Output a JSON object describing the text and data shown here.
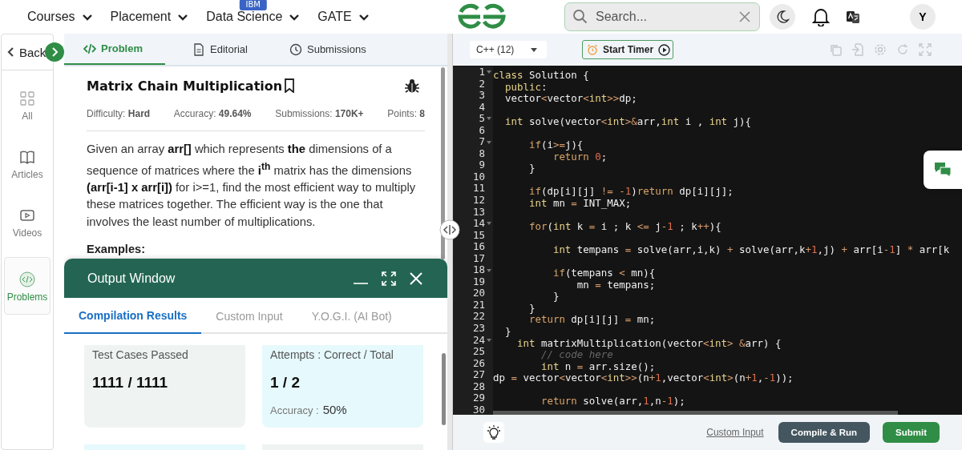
{
  "top_nav": {
    "menus": [
      {
        "label": "Courses"
      },
      {
        "label": "Placement"
      },
      {
        "label": "Data Science",
        "badge": "IBM"
      },
      {
        "label": "GATE"
      }
    ],
    "search": {
      "placeholder": "Search..."
    },
    "avatar": "Y"
  },
  "sidebar": {
    "back": "Back",
    "items": [
      {
        "label": "All",
        "selected": false
      },
      {
        "label": "Articles",
        "selected": false
      },
      {
        "label": "Videos",
        "selected": false
      },
      {
        "label": "Problems",
        "selected": true
      }
    ]
  },
  "problem_tabs": [
    {
      "label": "Problem",
      "selected": true
    },
    {
      "label": "Editorial",
      "selected": false
    },
    {
      "label": "Submissions",
      "selected": false
    }
  ],
  "problem": {
    "title": "Matrix Chain Multiplication",
    "meta": [
      {
        "label": "Difficulty:",
        "value": "Hard"
      },
      {
        "label": "Accuracy:",
        "value": "49.64%"
      },
      {
        "label": "Submissions:",
        "value": "170K+"
      },
      {
        "label": "Points:",
        "value": "8"
      }
    ],
    "description": "Given an array **arr[]** which represents **the** dimensions of a sequence of matrices where the **i**$^{th}$ matrix has the dimensions **(arr[i-1] x arr[i])** for i>=1, find the most efficient way to multiply these matrices together. The efficient way is the one that involves the least number of multiplications.",
    "examples_heading": "Examples:"
  },
  "output_window": {
    "title": "Output Window",
    "tabs": [
      {
        "label": "Compilation Results",
        "selected": true
      },
      {
        "label": "Custom Input",
        "selected": false
      },
      {
        "label": "Y.O.G.I. (AI Bot)",
        "selected": false
      }
    ],
    "cards": [
      {
        "label": "Test Cases Passed",
        "value": "1111 / 1111",
        "color": "#eff4f3"
      },
      {
        "label": "Attempts : Correct / Total",
        "value": "1 / 2",
        "note_label": "Accuracy :",
        "note_value": "50%",
        "color": "#e6f9fd"
      },
      {
        "color": "#e6f9fd"
      },
      {
        "color": "#eff4f3"
      }
    ]
  },
  "editor": {
    "language": "C++ (12)",
    "timer_button": "Start Timer",
    "lines": [
      {
        "number": "1",
        "foldable": true,
        "code": "class Solution {"
      },
      {
        "number": "2",
        "foldable": false,
        "code": "  public:"
      },
      {
        "number": "3",
        "foldable": false,
        "code": "  vector<vector<int>>dp;"
      },
      {
        "number": "4",
        "foldable": false
      },
      {
        "number": "5",
        "foldable": true,
        "code": "  int solve(vector<int>&arr,int i , int j){"
      },
      {
        "number": "6",
        "foldable": false
      },
      {
        "number": "7",
        "foldable": true,
        "code": "      if(i>=j){"
      },
      {
        "number": "8",
        "foldable": false,
        "code": "          return 0;"
      },
      {
        "number": "9",
        "foldable": false,
        "code": "      }"
      },
      {
        "number": "10",
        "foldable": false
      },
      {
        "number": "11",
        "foldable": false,
        "code": "      if(dp[i][j] != -1)return dp[i][j];"
      },
      {
        "number": "12",
        "foldable": false,
        "code": "      int mn = INT_MAX;"
      },
      {
        "number": "13",
        "foldable": false
      },
      {
        "number": "14",
        "foldable": true,
        "code": "      for(int k = i ; k <= j-1 ; k++){"
      },
      {
        "number": "15",
        "foldable": false
      },
      {
        "number": "16",
        "foldable": false,
        "code": "          int tempans = solve(arr,i,k) + solve(arr,k+1,j) + arr[i-1] * arr[k"
      },
      {
        "number": "17",
        "foldable": false
      },
      {
        "number": "18",
        "foldable": true,
        "code": "          if(tempans < mn){"
      },
      {
        "number": "19",
        "foldable": false,
        "code": "              mn = tempans;"
      },
      {
        "number": "20",
        "foldable": false,
        "code": "          }"
      },
      {
        "number": "21",
        "foldable": false,
        "code": "      }"
      },
      {
        "number": "22",
        "foldable": false,
        "code": "      return dp[i][j] = mn;"
      },
      {
        "number": "23",
        "foldable": false,
        "code": "  }"
      },
      {
        "number": "24",
        "foldable": true,
        "code": "    int matrixMultiplication(vector<int> &arr) {"
      },
      {
        "number": "25",
        "foldable": false,
        "code": "        // code here"
      },
      {
        "number": "26",
        "foldable": false,
        "code": "        int n = arr.size();"
      },
      {
        "number": "27",
        "foldable": false,
        "code": "dp = vector<vector<int>>(n+1,vector<int>(n+1,-1));"
      },
      {
        "number": "28",
        "foldable": false
      },
      {
        "number": "29",
        "foldable": false,
        "code": "        return solve(arr,1,n-1);"
      },
      {
        "number": "30",
        "foldable": false
      }
    ]
  },
  "footer": {
    "custom_input": "Custom Input",
    "compile_button": "Compile & Run",
    "submit_button": "Submit"
  }
}
